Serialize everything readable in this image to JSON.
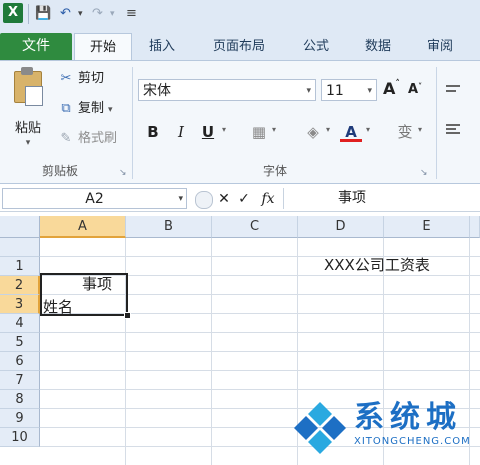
{
  "tabs": [
    "文件",
    "开始",
    "插入",
    "页面布局",
    "公式",
    "数据",
    "审阅"
  ],
  "clipboard": {
    "paste": "粘贴",
    "cut": "剪切",
    "copy": "复制",
    "format_painter": "格式刷",
    "group_label": "剪贴板"
  },
  "font": {
    "name": "宋体",
    "size": "11",
    "grow": "A",
    "shrink": "A",
    "bold": "B",
    "italic": "I",
    "underline": "U",
    "color_letter": "A",
    "phonetic": "变",
    "group_label": "字体"
  },
  "formula_bar": {
    "name_box": "A2",
    "cancel": "✕",
    "enter": "✓",
    "fx": "fx",
    "value": "事项"
  },
  "grid": {
    "columns": [
      "A",
      "B",
      "C",
      "D",
      "E"
    ],
    "rows": [
      "1",
      "2",
      "3",
      "4",
      "5",
      "6",
      "7",
      "8",
      "9",
      "10"
    ],
    "cells": {
      "D1": "XXX公司工资表",
      "A2": "事项",
      "A3": "姓名"
    }
  },
  "watermark": {
    "title": "系统城",
    "sub": "XITONGCHENG.COM"
  },
  "colors": {
    "file_tab": "#2f8b3f",
    "selection_header": "#f9d99a",
    "watermark": "#1d6fc4"
  }
}
